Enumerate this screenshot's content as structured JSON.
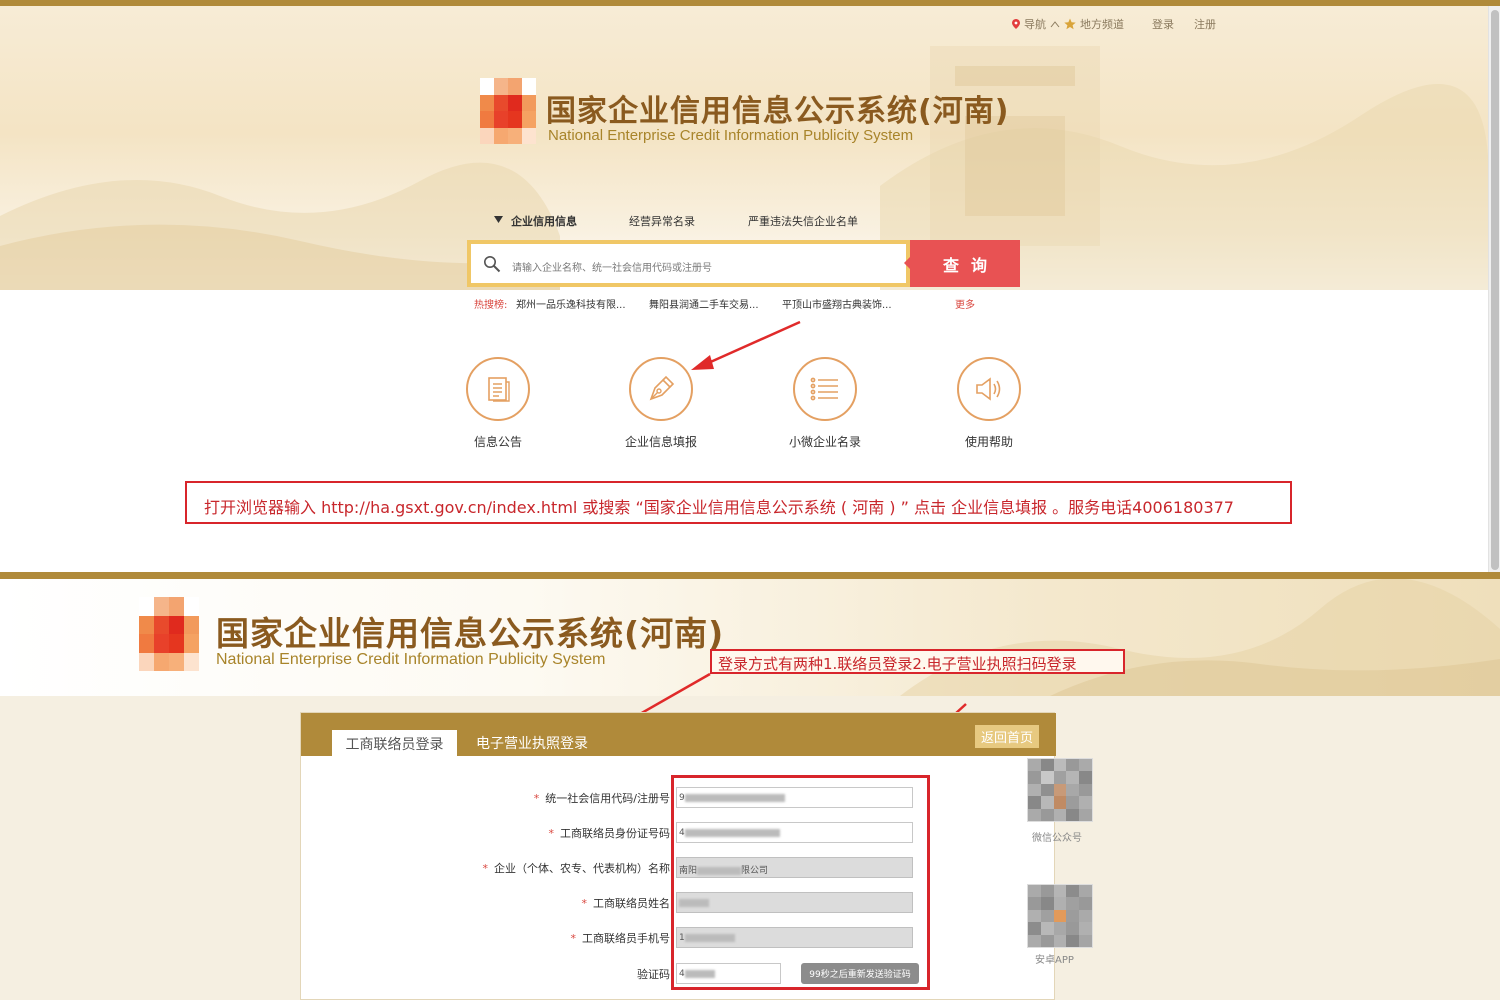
{
  "topnav": {
    "nav_label": "导航",
    "local_label": "地方频道",
    "login_label": "登录",
    "register_label": "注册"
  },
  "header": {
    "title": "国家企业信用信息公示系统(河南)",
    "subtitle": "National Enterprise Credit Information Publicity System"
  },
  "search": {
    "tabs": [
      "企业信用信息",
      "经营异常名录",
      "严重违法失信企业名单"
    ],
    "placeholder": "请输入企业名称、统一社会信用代码或注册号",
    "button_label": "查询",
    "hot_label": "热搜榜:",
    "hot_items": [
      "郑州一品乐逸科技有限...",
      "舞阳县润通二手车交易...",
      "平顶山市盛翔古典装饰..."
    ],
    "more_label": "更多"
  },
  "features": [
    {
      "label": "信息公告",
      "icon": "document-icon"
    },
    {
      "label": "企业信息填报",
      "icon": "pen-icon"
    },
    {
      "label": "小微企业名录",
      "icon": "list-icon"
    },
    {
      "label": "使用帮助",
      "icon": "speaker-icon"
    }
  ],
  "note": {
    "text": "打开浏览器输入 http://ha.gsxt.gov.cn/index.html 或搜索 “国家企业信用信息公示系统 ( 河南 ) ” 点击 企业信息填报 。服务电话4006180377"
  },
  "login_section": {
    "header_title": "国家企业信用信息公示系统(河南)",
    "header_subtitle": "National Enterprise Credit Information Publicity System",
    "annotation": "登录方式有两种1.联络员登录2.电子营业执照扫码登录",
    "tab_contact": "工商联络员登录",
    "tab_license": "电子营业执照登录",
    "back_home": "返回首页",
    "fields": [
      {
        "label": "统一社会信用代码/注册号",
        "value": "9",
        "required": true
      },
      {
        "label": "工商联络员身份证号码",
        "value": "4",
        "required": true
      },
      {
        "label": "企业（个体、农专、代表机构）名称",
        "value": "南阳",
        "value_suffix": "限公司",
        "required": true
      },
      {
        "label": "工商联络员姓名",
        "value": "",
        "required": true
      },
      {
        "label": "工商联络员手机号",
        "value": "1",
        "required": true
      },
      {
        "label": "验证码",
        "value": "4",
        "required": false
      }
    ],
    "send_code_label": "99秒之后重新发送验证码",
    "qr_wechat_label": "微信公众号",
    "qr_android_label": "安卓APP"
  },
  "colors": {
    "brand_gold": "#b08a3a",
    "title_brown": "#8a5a1f",
    "search_red": "#e85253",
    "annotation_red": "#d8252b",
    "icon_orange": "#e4a062"
  }
}
